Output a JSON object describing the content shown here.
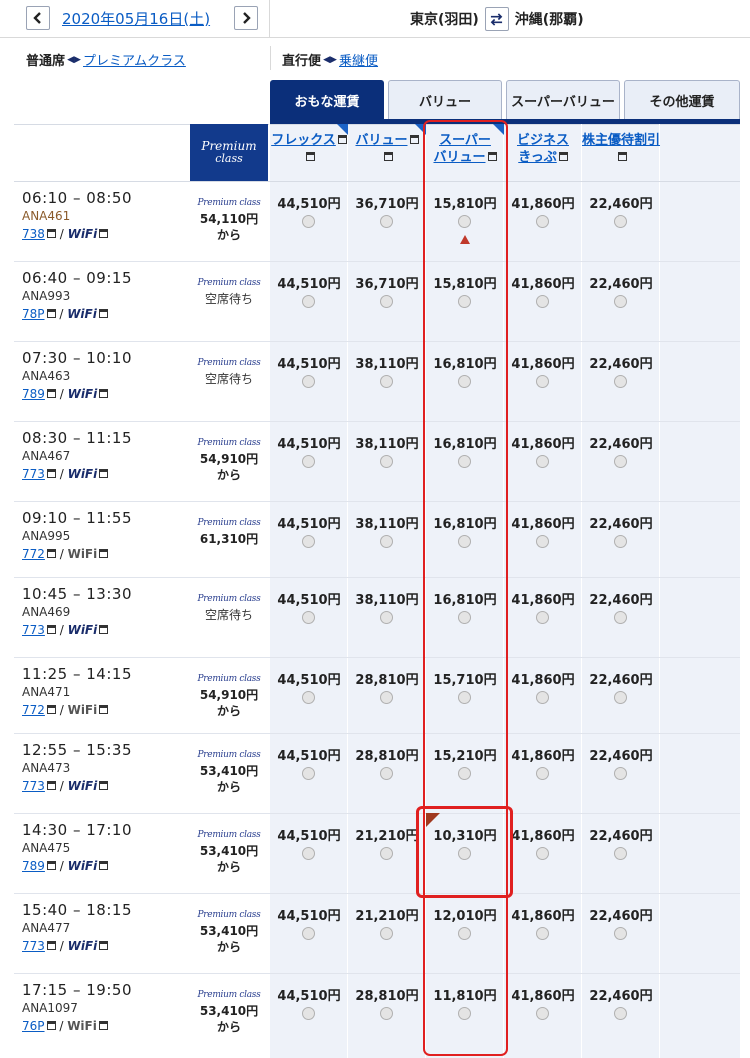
{
  "topbar": {
    "date": "2020年05月16日(土)",
    "origin": "東京(羽田)",
    "destination": "沖縄(那覇)"
  },
  "seat_class": {
    "selected": "普通席",
    "other": "プレミアムクラス"
  },
  "route_type": {
    "selected": "直行便",
    "other": "乗継便"
  },
  "tabs": [
    {
      "label": "おもな運賃",
      "active": true
    },
    {
      "label": "バリュー",
      "active": false
    },
    {
      "label": "スーパーバリュー",
      "active": false
    },
    {
      "label": "その他運賃",
      "active": false
    }
  ],
  "premium_header": {
    "line1": "Premium",
    "line2": "class"
  },
  "premium_logo": "Premium class",
  "fare_columns": [
    {
      "lines": [
        "フレックス"
      ]
    },
    {
      "lines": [
        "バリュー"
      ]
    },
    {
      "lines": [
        "スーパー",
        "バリュー"
      ]
    },
    {
      "lines": [
        "ビジネス",
        "きっぷ"
      ]
    },
    {
      "lines": [
        "株主優待割引"
      ]
    }
  ],
  "flights": [
    {
      "time": "06:10 – 08:50",
      "number": "ANA461",
      "aircraft": "738",
      "wifi": "WiFi",
      "premium_price": "54,110円",
      "premium_suffix": "から",
      "premium_status": "",
      "fares": [
        "44,510円",
        "36,710円",
        "15,810円",
        "41,860円",
        "22,460円"
      ]
    },
    {
      "time": "06:40 – 09:15",
      "number": "ANA993",
      "aircraft": "78P",
      "wifi": "WiFi",
      "premium_price": "",
      "premium_suffix": "",
      "premium_status": "空席待ち",
      "fares": [
        "44,510円",
        "36,710円",
        "15,810円",
        "41,860円",
        "22,460円"
      ]
    },
    {
      "time": "07:30 – 10:10",
      "number": "ANA463",
      "aircraft": "789",
      "wifi": "WiFi",
      "premium_price": "",
      "premium_suffix": "",
      "premium_status": "空席待ち",
      "fares": [
        "44,510円",
        "38,110円",
        "16,810円",
        "41,860円",
        "22,460円"
      ]
    },
    {
      "time": "08:30 – 11:15",
      "number": "ANA467",
      "aircraft": "773",
      "wifi": "WiFi",
      "premium_price": "54,910円",
      "premium_suffix": "から",
      "premium_status": "",
      "fares": [
        "44,510円",
        "38,110円",
        "16,810円",
        "41,860円",
        "22,460円"
      ]
    },
    {
      "time": "09:10 – 11:55",
      "number": "ANA995",
      "aircraft": "772",
      "wifi": "WiFi",
      "premium_price": "61,310円",
      "premium_suffix": "",
      "premium_status": "",
      "fares": [
        "44,510円",
        "38,110円",
        "16,810円",
        "41,860円",
        "22,460円"
      ]
    },
    {
      "time": "10:45 – 13:30",
      "number": "ANA469",
      "aircraft": "773",
      "wifi": "WiFi",
      "premium_price": "",
      "premium_suffix": "",
      "premium_status": "空席待ち",
      "fares": [
        "44,510円",
        "38,110円",
        "16,810円",
        "41,860円",
        "22,460円"
      ]
    },
    {
      "time": "11:25 – 14:15",
      "number": "ANA471",
      "aircraft": "772",
      "wifi": "WiFi",
      "premium_price": "54,910円",
      "premium_suffix": "から",
      "premium_status": "",
      "fares": [
        "44,510円",
        "28,810円",
        "15,710円",
        "41,860円",
        "22,460円"
      ]
    },
    {
      "time": "12:55 – 15:35",
      "number": "ANA473",
      "aircraft": "773",
      "wifi": "WiFi",
      "premium_price": "53,410円",
      "premium_suffix": "から",
      "premium_status": "",
      "fares": [
        "44,510円",
        "28,810円",
        "15,210円",
        "41,860円",
        "22,460円"
      ]
    },
    {
      "time": "14:30 – 17:10",
      "number": "ANA475",
      "aircraft": "789",
      "wifi": "WiFi",
      "premium_price": "53,410円",
      "premium_suffix": "から",
      "premium_status": "",
      "fares": [
        "44,510円",
        "21,210円",
        "10,310円",
        "41,860円",
        "22,460円"
      ]
    },
    {
      "time": "15:40 – 18:15",
      "number": "ANA477",
      "aircraft": "773",
      "wifi": "WiFi",
      "premium_price": "53,410円",
      "premium_suffix": "から",
      "premium_status": "",
      "fares": [
        "44,510円",
        "21,210円",
        "12,010円",
        "41,860円",
        "22,460円"
      ]
    },
    {
      "time": "17:15 – 19:50",
      "number": "ANA1097",
      "aircraft": "76P",
      "wifi": "WiFi",
      "premium_price": "53,410円",
      "premium_suffix": "から",
      "premium_status": "",
      "fares": [
        "44,510円",
        "28,810円",
        "11,810円",
        "41,860円",
        "22,460円"
      ]
    }
  ]
}
